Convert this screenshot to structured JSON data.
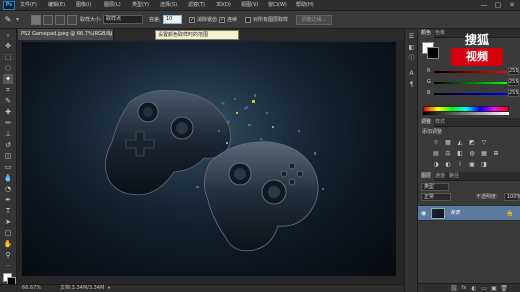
{
  "app": {
    "logo": "Ps",
    "menu": [
      "文件(F)",
      "编辑(E)",
      "图像(I)",
      "图层(L)",
      "类型(Y)",
      "选择(S)",
      "滤镜(T)",
      "3D(D)",
      "视图(V)",
      "窗口(W)",
      "帮助(H)"
    ],
    "window_controls": [
      "—",
      "▢",
      "✕"
    ]
  },
  "options": {
    "sample_size_label": "取样大小:",
    "sample_size_value": "取样点",
    "tolerance_label": "容差:",
    "tolerance_value": "10",
    "antialias_label": "消除锯齿",
    "contiguous_label": "连续",
    "all_layers_label": "对所有图层取样",
    "refine_button": "调整边缘..."
  },
  "tooltip": "设置颜色取样时的范围",
  "document": {
    "tab_title": "PS2 Gamepad.jpeg @ 66.7%(RGB/8)",
    "close": "×"
  },
  "status": {
    "zoom": "66.67%",
    "doc_size": "文档:3.34M/3.34M"
  },
  "color_panel": {
    "tabs": [
      "颜色",
      "色板"
    ],
    "sliders": [
      {
        "label": "R",
        "value": "255",
        "color": "#ff3b3b"
      },
      {
        "label": "G",
        "value": "255",
        "color": "#3bff3b"
      },
      {
        "label": "B",
        "value": "255",
        "color": "#3b6bff"
      }
    ]
  },
  "adjust_panel": {
    "tabs": [
      "调整",
      "样式"
    ],
    "add_label": "添加调整",
    "row1": [
      "☼",
      "▦",
      "◭",
      "◩",
      "▽"
    ],
    "row2": [
      "▤",
      "⚖",
      "◧",
      "◍",
      "▦",
      "⊞"
    ],
    "row3": [
      "◑",
      "◐",
      "⌇",
      "▣",
      "◨"
    ]
  },
  "layers_panel": {
    "tabs": [
      "图层",
      "通道",
      "路径"
    ],
    "kind_label": "类型",
    "blend_mode": "正常",
    "opacity_label": "不透明度:",
    "opacity_value": "100%",
    "lock_label": "锁定:",
    "fill_label": "填充:",
    "fill_value": "100%",
    "layer_name": "背景",
    "footer_icons": [
      "⛓",
      "fx",
      "◐",
      "▭",
      "▣",
      "🗑"
    ]
  },
  "watermark": {
    "top": "搜狐",
    "bottom": "视频",
    "badge_color": "#d7000f"
  }
}
